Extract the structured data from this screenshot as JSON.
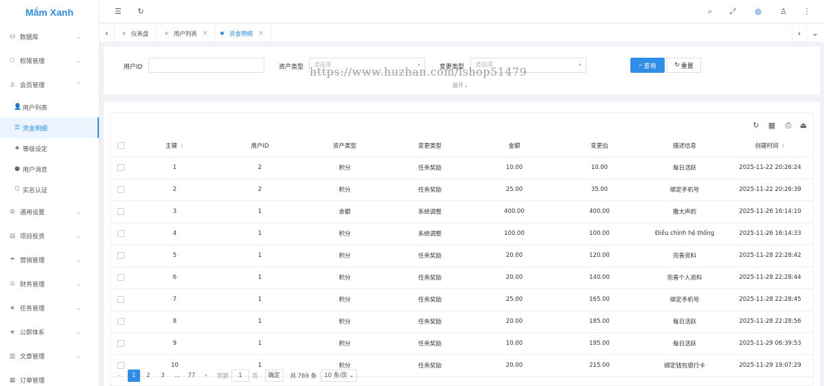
{
  "app": {
    "title": "Mắm Xanh"
  },
  "sidebar": {
    "items": [
      {
        "label": "数据库",
        "icon": "database-icon",
        "arrow": "⌄"
      },
      {
        "label": "权限管理",
        "icon": "shield-icon",
        "arrow": "⌄"
      },
      {
        "label": "会员管理",
        "icon": "user-icon",
        "arrow": "⌃"
      },
      {
        "label": "通用设置",
        "icon": "gear-icon",
        "arrow": "⌄"
      },
      {
        "label": "项目投资",
        "icon": "invest-icon",
        "arrow": "⌄"
      },
      {
        "label": "营销管理",
        "icon": "marketing-icon",
        "arrow": "⌄"
      },
      {
        "label": "财务管理",
        "icon": "finance-icon",
        "arrow": "⌄"
      },
      {
        "label": "任务管理",
        "icon": "star-icon",
        "arrow": "⌄"
      },
      {
        "label": "公薪体系",
        "icon": "star-icon",
        "arrow": "⌄"
      },
      {
        "label": "文章管理",
        "icon": "book-icon",
        "arrow": "⌄"
      },
      {
        "label": "订单管理",
        "icon": "calendar-icon",
        "arrow": ""
      }
    ],
    "subitems": [
      {
        "label": "用户列表",
        "icon": "person-icon"
      },
      {
        "label": "资金明细",
        "icon": "list-icon"
      },
      {
        "label": "等级设定",
        "icon": "star-icon"
      },
      {
        "label": "用户消息",
        "icon": "message-icon"
      },
      {
        "label": "实名认证",
        "icon": "verify-icon"
      }
    ]
  },
  "tabs": [
    {
      "label": "仪表盘"
    },
    {
      "label": "用户列表"
    },
    {
      "label": "资金明细"
    }
  ],
  "search": {
    "user_id_label": "用户ID",
    "user_id_value": "",
    "asset_type_label": "资产类型",
    "asset_type_placeholder": "请选择",
    "change_type_label": "变更类型",
    "change_type_placeholder": "请选择",
    "query_label": "查询",
    "reset_label": "重置",
    "expand_label": "展开",
    "watermark": "https://www.huzhan.com/ishop51479"
  },
  "table": {
    "columns": [
      "主键",
      "用户ID",
      "资产类型",
      "变更类型",
      "金额",
      "变更后",
      "描述信息",
      "创建时间"
    ],
    "rows": [
      [
        "1",
        "2",
        "积分",
        "任务奖励",
        "10.00",
        "10.00",
        "每日活跃",
        "2025-11-22 20:26:24"
      ],
      [
        "2",
        "2",
        "积分",
        "任务奖励",
        "25.00",
        "35.00",
        "绑定手机号",
        "2025-11-22 20:26:39"
      ],
      [
        "3",
        "1",
        "余额",
        "系统调整",
        "400.00",
        "400.00",
        "撒大声的",
        "2025-11-26 16:14:10"
      ],
      [
        "4",
        "1",
        "积分",
        "系统调整",
        "100.00",
        "100.00",
        "Điều chỉnh hệ thống",
        "2025-11-26 16:14:33"
      ],
      [
        "5",
        "1",
        "积分",
        "任务奖励",
        "20.00",
        "120.00",
        "完善资料",
        "2025-11-28 22:28:42"
      ],
      [
        "6",
        "1",
        "积分",
        "任务奖励",
        "20.00",
        "140.00",
        "完善个人资料",
        "2025-11-28 22:28:44"
      ],
      [
        "7",
        "1",
        "积分",
        "任务奖励",
        "25.00",
        "165.00",
        "绑定手机号",
        "2025-11-28 22:28:45"
      ],
      [
        "8",
        "1",
        "积分",
        "任务奖励",
        "20.00",
        "185.00",
        "每日活跃",
        "2025-11-28 22:28:56"
      ],
      [
        "9",
        "1",
        "积分",
        "任务奖励",
        "10.00",
        "195.00",
        "每日活跃",
        "2025-11-29 06:39:53"
      ],
      [
        "10",
        "1",
        "积分",
        "任务奖励",
        "20.00",
        "215.00",
        "绑定钱包银行卡",
        "2025-11-29 19:07:29"
      ]
    ]
  },
  "pagination": {
    "pages": [
      "1",
      "2",
      "3",
      "...",
      "77"
    ],
    "goto_label": "到第",
    "goto_value": "1",
    "page_unit": "页",
    "confirm_label": "确定",
    "total_label": "共 769 条",
    "page_size": "10 条/页"
  },
  "colors": {
    "accent": "#2f8fe8"
  }
}
